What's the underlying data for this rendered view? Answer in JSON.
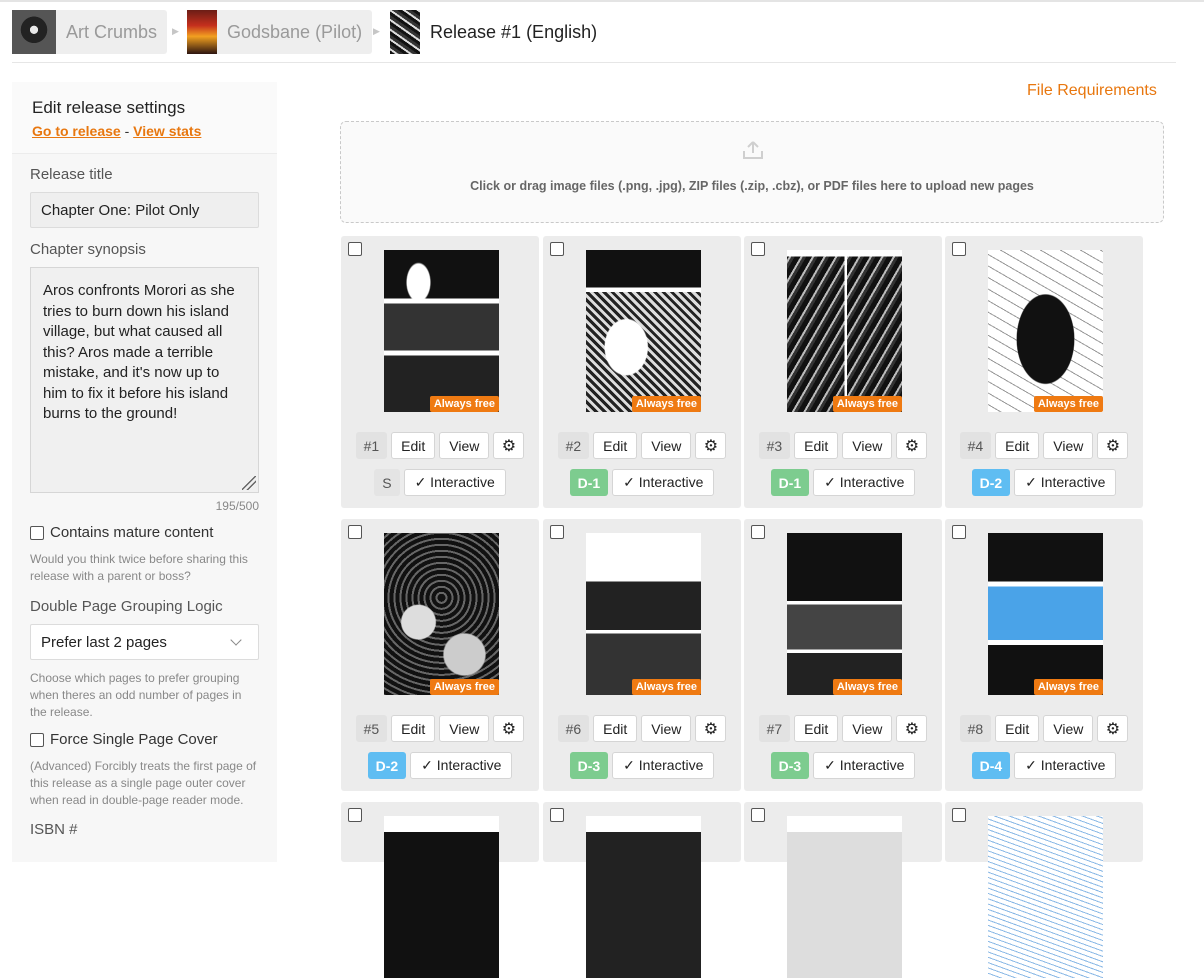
{
  "breadcrumb": [
    {
      "label": "Art Crumbs",
      "thumb": "avatar-art-crumbs"
    },
    {
      "label": "Godsbane (Pilot)",
      "thumb": "comic-cover-godsbane"
    },
    {
      "label": "Release #1 (English)",
      "thumb": "release-cover"
    }
  ],
  "sidebar": {
    "heading": "Edit release settings",
    "go_to_release": "Go to release",
    "separator": "-",
    "view_stats": "View stats",
    "release_title_label": "Release title",
    "release_title_value": "Chapter One: Pilot Only",
    "synopsis_label": "Chapter synopsis",
    "synopsis_value": "Aros confronts Morori as she tries to burn down his island village, but what caused all this? Aros made a terrible mistake, and it's now up to him to fix it before his island burns to the ground!",
    "synopsis_counter": "195/500",
    "mature_label": "Contains mature content",
    "mature_help": "Would you think twice before sharing this release with a parent or boss?",
    "grouping_label": "Double Page Grouping Logic",
    "grouping_value": "Prefer last 2 pages",
    "grouping_help": "Choose which pages to prefer grouping when theres an odd number of pages in the release.",
    "force_cover_label": "Force Single Page Cover",
    "force_cover_help": "(Advanced) Forcibly treats the first page of this release as a single page outer cover when read in double-page reader mode.",
    "isbn_label": "ISBN #"
  },
  "main": {
    "file_requirements": "File Requirements",
    "upload_text": "Click or drag image files (.png, .jpg), ZIP files (.zip, .cbz), or PDF files here to upload new pages",
    "edit_label": "Edit",
    "view_label": "View",
    "interactive_label": "✓ Interactive",
    "free_badge": "Always free",
    "pages": [
      {
        "num": "#1",
        "spread": "S"
      },
      {
        "num": "#2",
        "spread": "D-1"
      },
      {
        "num": "#3",
        "spread": "D-1"
      },
      {
        "num": "#4",
        "spread": "D-2"
      },
      {
        "num": "#5",
        "spread": "D-2"
      },
      {
        "num": "#6",
        "spread": "D-3"
      },
      {
        "num": "#7",
        "spread": "D-3"
      },
      {
        "num": "#8",
        "spread": "D-4"
      }
    ]
  },
  "colors": {
    "accent": "#e8770f",
    "free_badge": "#ef7a12",
    "spread_green": "#7dcc8f",
    "spread_blue": "#5fbdf2"
  }
}
